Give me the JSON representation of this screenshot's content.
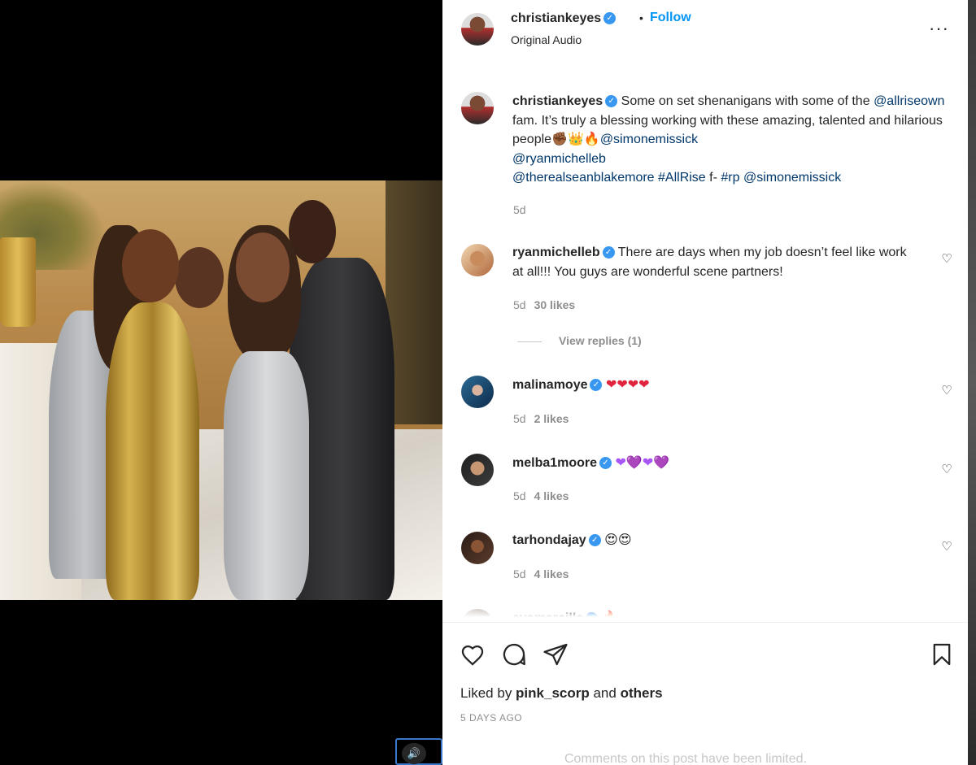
{
  "header": {
    "username": "christiankeyes",
    "dot": "•",
    "follow_label": "Follow",
    "audio_label": "Original Audio",
    "more_label": "···"
  },
  "caption": {
    "username": "christiankeyes",
    "text_1": "Some on set shenanigans with some of the",
    "mention_1": "@allriseown",
    "text_2": " fam. It’s truly a blessing working with these amazing, talented and hilarious people",
    "emojis": "✊🏾👑🔥",
    "mention_2": "@simonemissick",
    "mention_3": "@ryanmichelleb",
    "mention_4": "@therealseanblakemore",
    "hashtag_1": "#AllRise",
    "text_3": " f- ",
    "hashtag_2": "#rp",
    "mention_5": "@simonemissick",
    "time": "5d"
  },
  "comments": [
    {
      "username": "ryanmichelleb",
      "text": "There are days when my job doesn’t feel like work at all!!! You guys are wonderful scene partners!",
      "time": "5d",
      "likes": "30 likes"
    },
    {
      "username": "malinamoye",
      "text": "❤❤❤❤",
      "time": "5d",
      "likes": "2 likes"
    },
    {
      "username": "melba1moore",
      "text": "❤💜❤💜",
      "time": "5d",
      "likes": "4 likes"
    },
    {
      "username": "tarhondajay",
      "text": "😍😍",
      "time": "5d",
      "likes": "4 likes"
    },
    {
      "username": "evamarcille",
      "text": "🔥",
      "time": "",
      "likes": ""
    }
  ],
  "replies_label": "View replies (1)",
  "likes_line": {
    "prefix": "Liked by ",
    "user": "pink_scorp",
    "middle": " and ",
    "others": "others"
  },
  "post_date": "5 DAYS AGO",
  "limited_text": "Comments on this post have been limited.",
  "sound_icon": "🔊",
  "colors": {
    "follow": "#0095f6",
    "verified": "#3897f0",
    "link": "#00376b",
    "muted": "#8e8e8e"
  }
}
